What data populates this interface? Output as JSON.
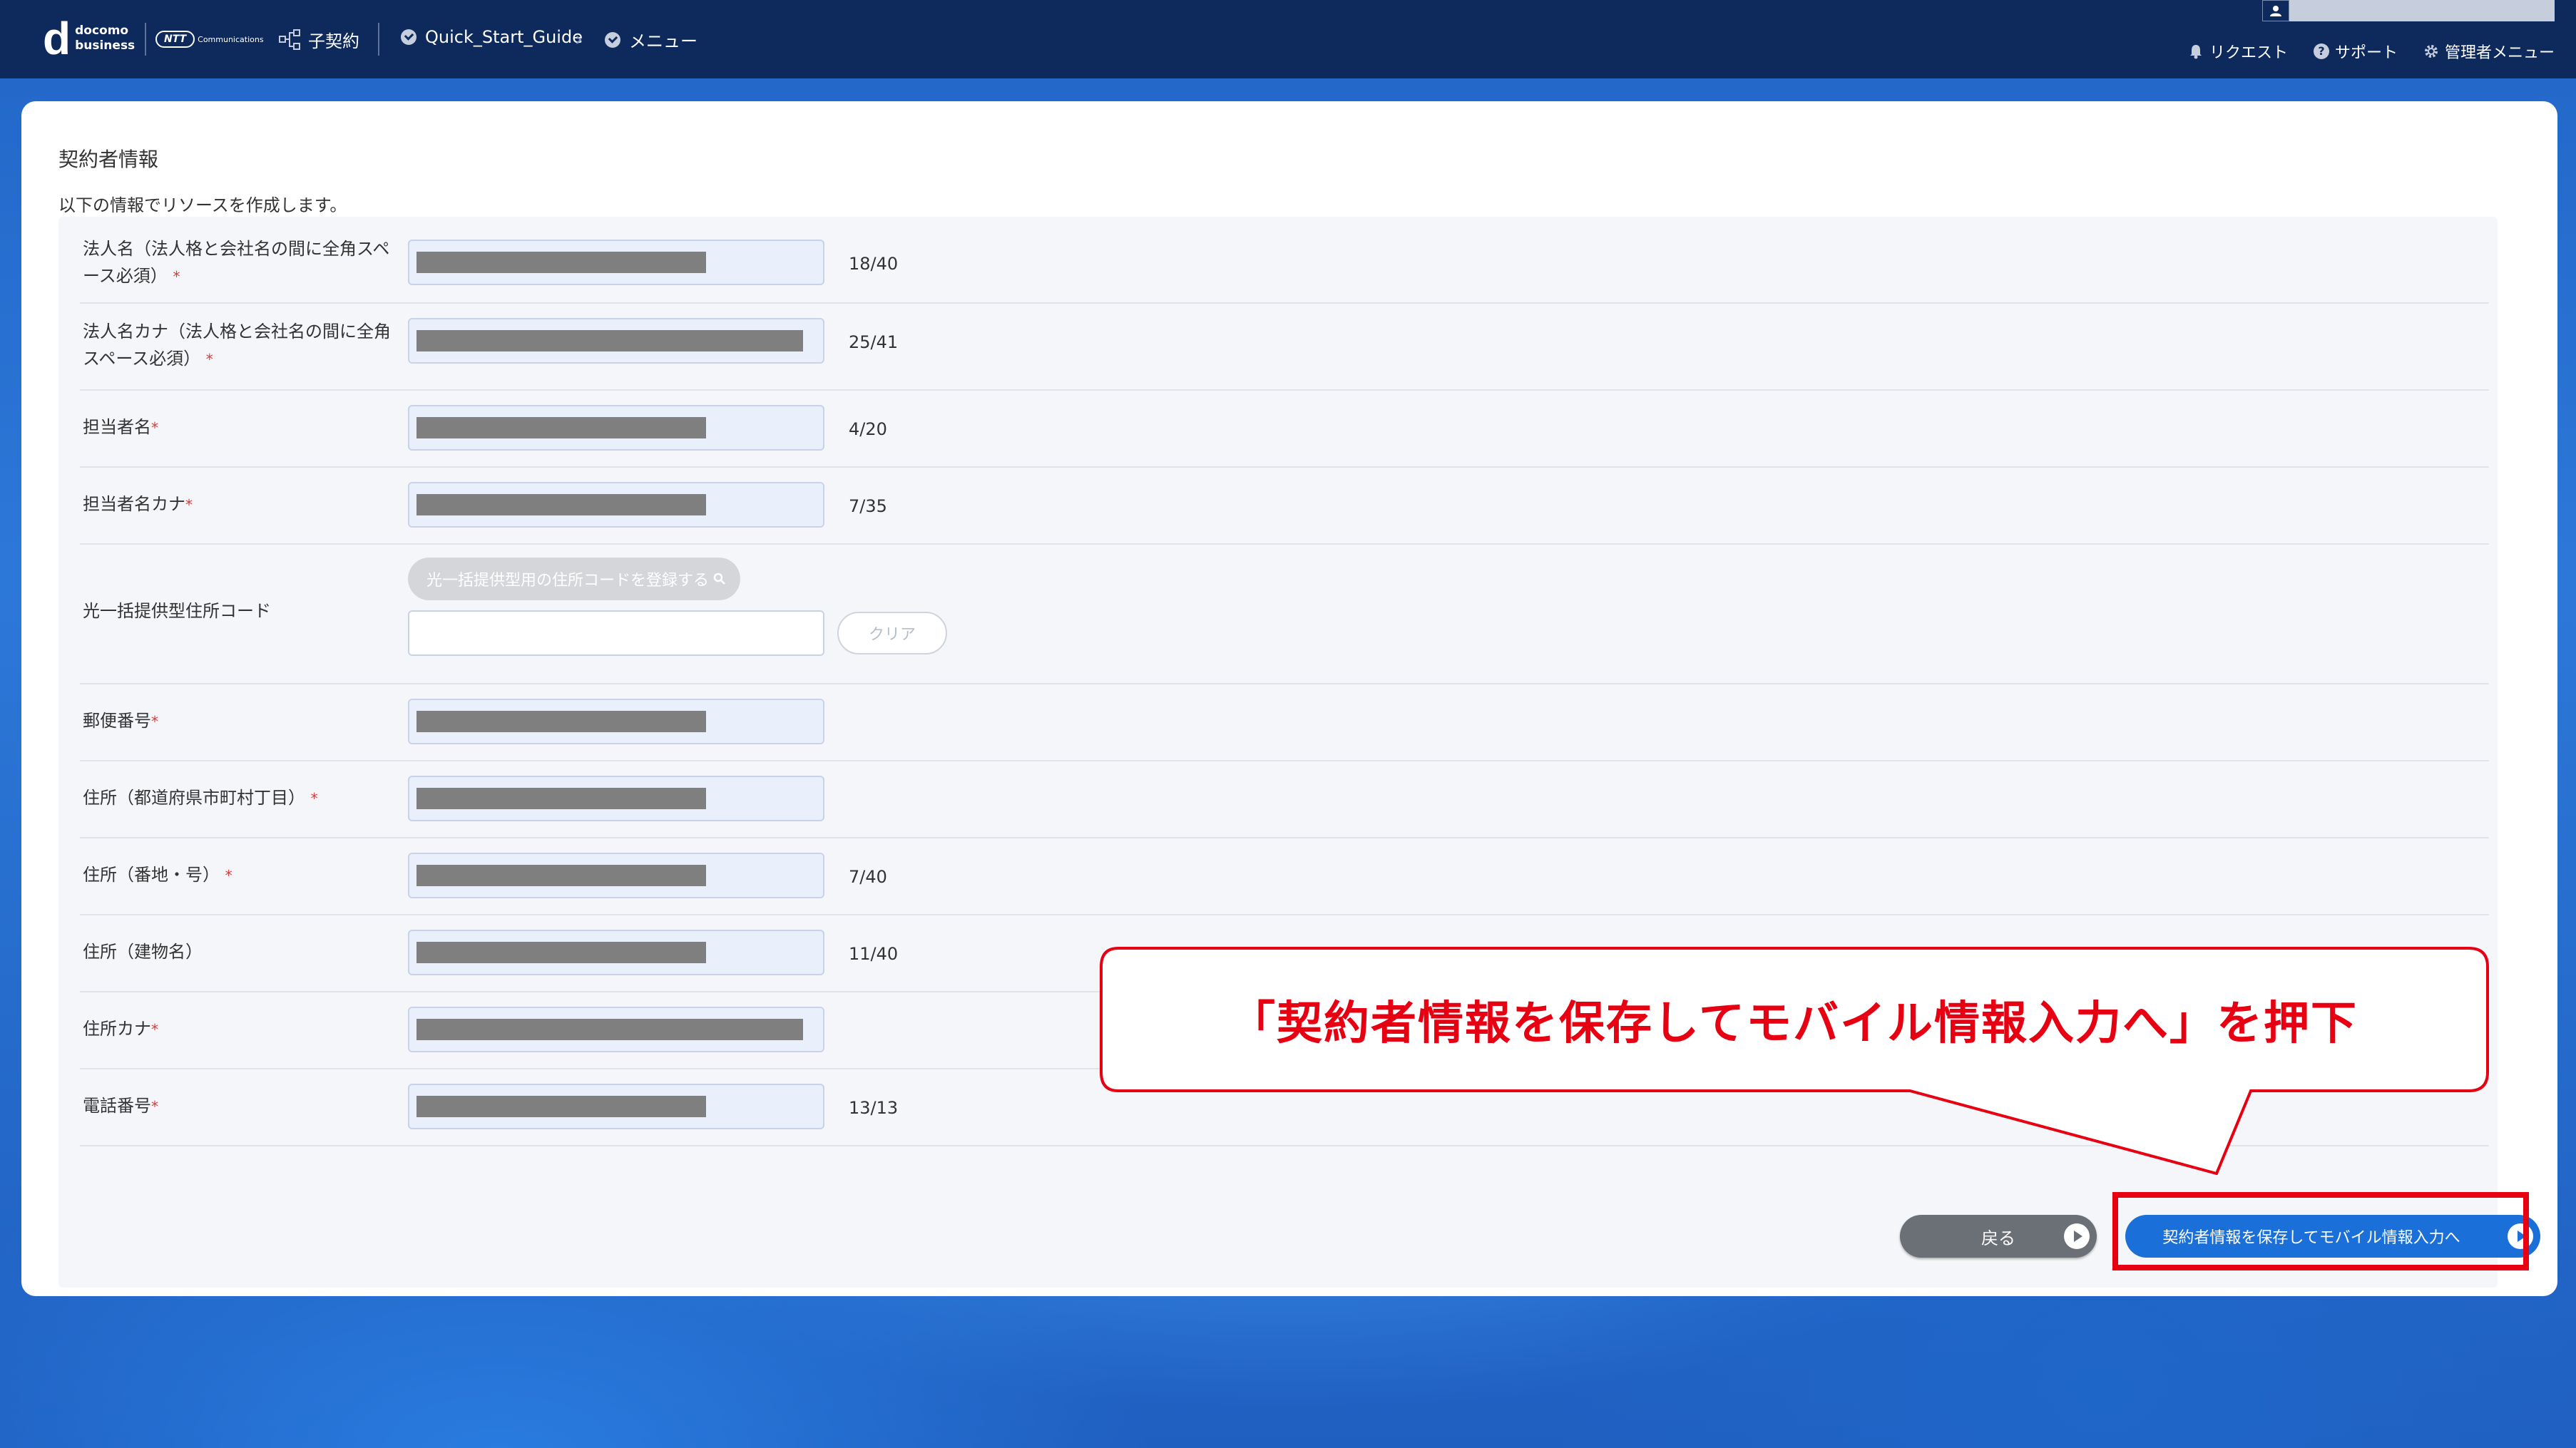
{
  "header": {
    "logo_main": "d",
    "logo_line1": "docomo",
    "logo_line2": "business",
    "ntt_logo": "NTT",
    "ntt_sub": "Communications",
    "breadcrumb": {
      "contract": "子契約",
      "guide": "Quick_Start_Guide",
      "menu": "メニュー"
    },
    "links": {
      "request": "リクエスト",
      "support": "サポート",
      "admin": "管理者メニュー"
    }
  },
  "page": {
    "title": "契約者情報",
    "description": "以下の情報でリソースを作成します。"
  },
  "form": {
    "rows": [
      {
        "label": "法人名（法人格と会社名の間に全角スペース必須）",
        "required": "*",
        "counter": "18/40"
      },
      {
        "label": "法人名カナ（法人格と会社名の間に全角スペース必須）",
        "required": "*",
        "counter": "25/41"
      },
      {
        "label": "担当者名",
        "required": "*",
        "counter": "4/20"
      },
      {
        "label": "担当者名カナ",
        "required": "*",
        "counter": "7/35"
      },
      {
        "label": "光一括提供型住所コード",
        "required": "",
        "counter": ""
      },
      {
        "label": "郵便番号",
        "required": "*",
        "counter": ""
      },
      {
        "label": "住所（都道府県市町村丁目）",
        "required": "*",
        "counter": ""
      },
      {
        "label": "住所（番地・号）",
        "required": "*",
        "counter": "7/40"
      },
      {
        "label": "住所（建物名）",
        "required": "",
        "counter": "11/40"
      },
      {
        "label": "住所カナ",
        "required": "*",
        "counter": ""
      },
      {
        "label": "電話番号",
        "required": "*",
        "counter": "13/13"
      }
    ],
    "lookup_button": "光一括提供型用の住所コードを登録する",
    "clear_button": "クリア"
  },
  "buttons": {
    "back": "戻る",
    "next": "契約者情報を保存してモバイル情報入力へ"
  },
  "callout": {
    "text": "「契約者情報を保存してモバイル情報入力へ」を押下"
  },
  "colors": {
    "header_bg": "#0e2a5c",
    "primary": "#1a6fd8",
    "annotation_red": "#e60012"
  }
}
